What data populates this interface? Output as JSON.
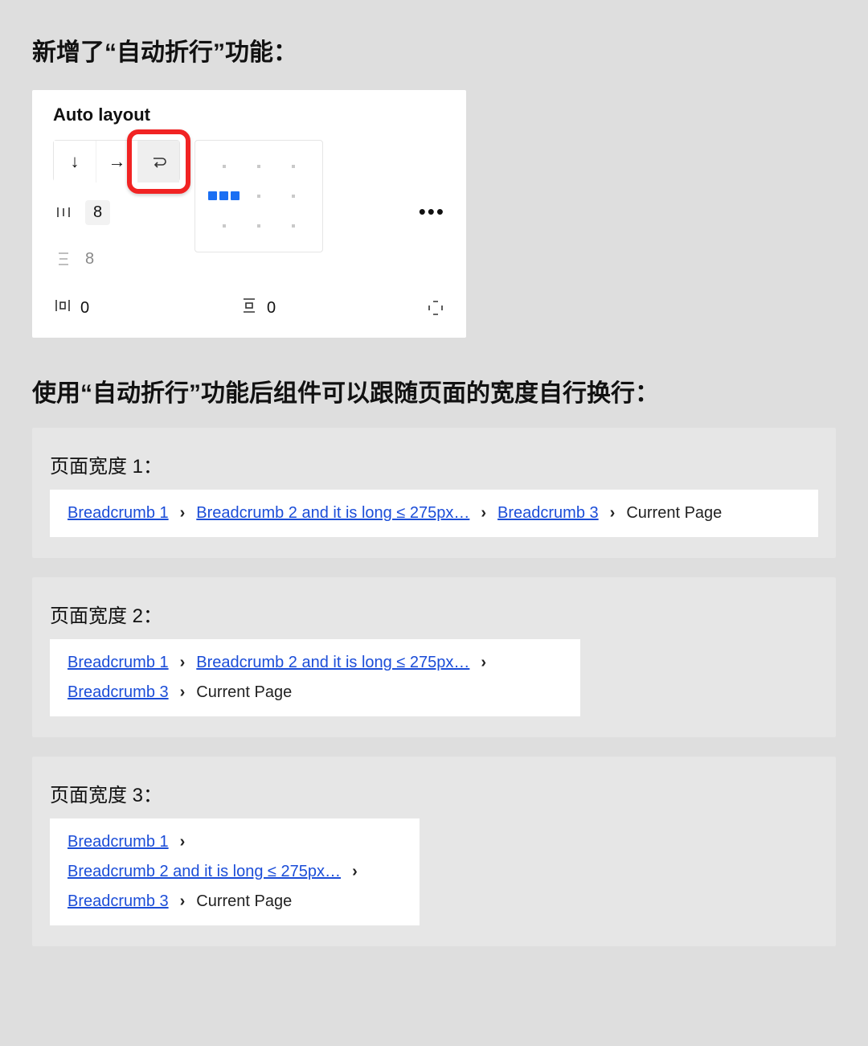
{
  "intro_heading": "新增了“自动折行”功能：",
  "panel": {
    "title": "Auto layout",
    "direction_buttons": {
      "vertical": "↓",
      "horizontal": "→",
      "wrap": "↩"
    },
    "horizontal_gap": "8",
    "vertical_gap": "8",
    "padding_h": "0",
    "padding_v": "0"
  },
  "intro_heading2": "使用“自动折行”功能后组件可以跟随页面的宽度自行换行：",
  "examples": [
    {
      "label": "页面宽度 1："
    },
    {
      "label": "页面宽度 2："
    },
    {
      "label": "页面宽度 3："
    }
  ],
  "breadcrumb": {
    "items": [
      {
        "text": "Breadcrumb 1",
        "link": true
      },
      {
        "text": "Breadcrumb 2 and it is long ≤ 275px…",
        "link": true
      },
      {
        "text": "Breadcrumb 3",
        "link": true
      },
      {
        "text": "Current Page",
        "link": false
      }
    ],
    "separator": "›"
  }
}
